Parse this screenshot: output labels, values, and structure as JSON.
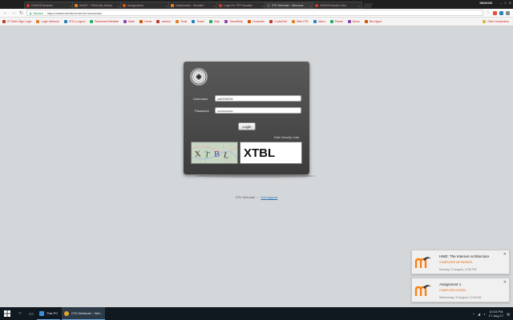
{
  "browser": {
    "tabs": [
      {
        "label": "DS5028 Modules",
        "fav": "#c0392b",
        "active": false
      },
      {
        "label": "IN4ATI - TRNA (My Notes)",
        "fav": "#e67e22",
        "active": false
      },
      {
        "label": "Assignments",
        "fav": "#d35400",
        "active": false
      },
      {
        "label": "Dashboards - Moodle2",
        "fav": "#e67e22",
        "active": false
      },
      {
        "label": "Login Fix TPP Moodle2",
        "fav": "#c0392b",
        "active": false
      },
      {
        "label": "IITD Webmail :: Welcome",
        "fav": "#555555",
        "active": true
      },
      {
        "label": "DS5028 Module Intro",
        "fav": "#c0392b",
        "active": false
      }
    ],
    "user": "DRAGON",
    "window_controls": [
      "–",
      "□",
      "✕"
    ],
    "secure_label": "Secure",
    "url": "https://webmail.iitd.ernet.in/roundcube/",
    "bookmarks": [
      "IIT Delhi Sign Login",
      "Login Network",
      "IITD | Logout",
      "Placement Website",
      "Bank",
      "Home",
      "careers",
      "Tools",
      "Travel",
      "Help",
      "TravelHelp",
      "Computer",
      "CodeChef",
      "Web IITD",
      "Intern",
      "Planet",
      "Wooo",
      "Bio-Hyper",
      "Other bookmarks"
    ]
  },
  "login": {
    "username_label": "Username",
    "username_value": "cs5100226",
    "password_label": "Password",
    "password_value": "••••••••••••••",
    "login_button": "Login",
    "captcha_label": "Enter Security Code",
    "captcha_value": "XTBL",
    "captcha_image_text": "XTBL"
  },
  "footer": {
    "left": "IITD Webmail",
    "link": "Get support"
  },
  "notifications": [
    {
      "title": "HWE: The Internet Architecture",
      "subtitle": "COMPUTER NETWORKS",
      "time": "Monday, 21 August, 11:55 PM"
    },
    {
      "title": "Assignment 1",
      "subtitle": "COMPUTER VISION",
      "time": "Wednesday, 23 August, 12:00 AM"
    }
  ],
  "taskbar": {
    "tasks": [
      {
        "label": "This PC",
        "color": "#3b8fd9",
        "active": false
      },
      {
        "label": "IITD Webmail :: Wel...",
        "color": "#e2a42b",
        "active": true
      }
    ],
    "time": "10:03 PM",
    "date": "17-Aug-17"
  },
  "colors": {
    "accent": "#2a6fb0",
    "moodle_orange": "#f98012",
    "notification_subtitle": "#e66000"
  }
}
